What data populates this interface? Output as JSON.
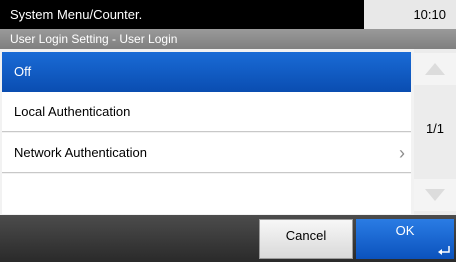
{
  "status_bar": {
    "title": "System Menu/Counter.",
    "time": "10:10"
  },
  "screen_title": "User Login Setting - User Login",
  "options": [
    {
      "label": "Off",
      "selected": true
    },
    {
      "label": "Local Authentication",
      "selected": false
    },
    {
      "label": "Network Authentication",
      "selected": false,
      "has_submenu": true
    }
  ],
  "pager": {
    "indicator": "1/1"
  },
  "buttons": {
    "cancel": "Cancel",
    "ok": "OK"
  },
  "colors": {
    "selected": "#0a4db1",
    "ok_button": "#1a6bd6",
    "top_bar": "#000000"
  }
}
